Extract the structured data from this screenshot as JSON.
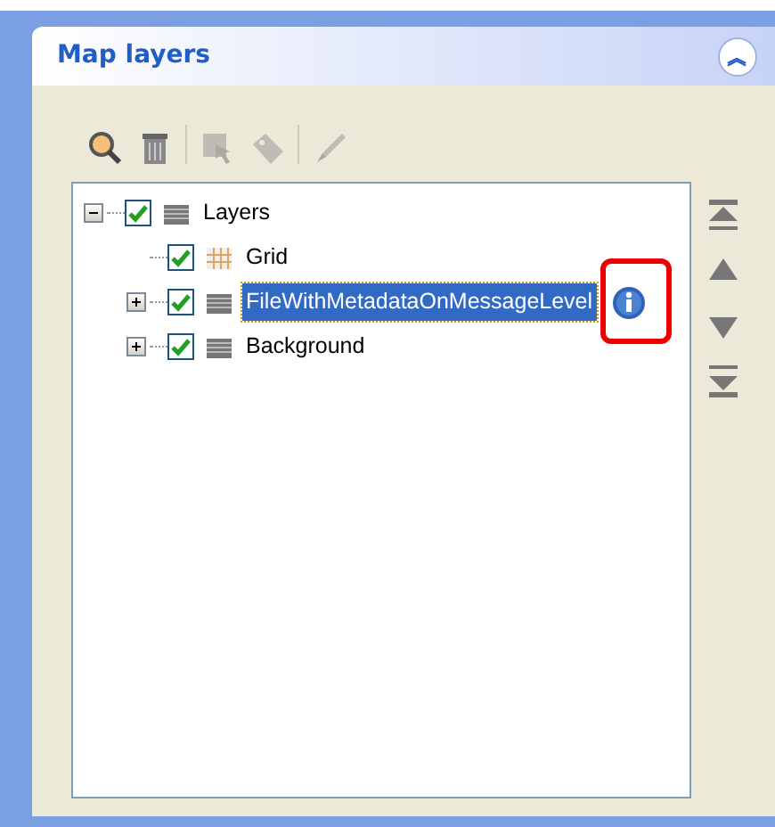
{
  "panel": {
    "title": "Map layers",
    "collapse_glyph": "︽",
    "expanded": true
  },
  "toolbar": [
    [
      {
        "kind": "zoom",
        "disabled": false
      },
      {
        "kind": "delete",
        "disabled": false
      }
    ],
    [
      {
        "kind": "select",
        "disabled": true
      },
      {
        "kind": "tag",
        "disabled": true
      }
    ],
    [
      {
        "kind": "brush",
        "disabled": true
      }
    ]
  ],
  "tree": [
    {
      "label": "Layers",
      "kind": "stack",
      "checked": true,
      "expanded": true,
      "selected": false,
      "children": [
        {
          "label": "Grid",
          "kind": "grid",
          "checked": true,
          "selected": false
        },
        {
          "label": "FileWithMetadataOnMessageLevel",
          "kind": "stack",
          "checked": true,
          "expanded": false,
          "selected": true,
          "info": true,
          "highlighted": true
        },
        {
          "label": "Background",
          "kind": "stack",
          "checked": true,
          "expanded": false,
          "selected": false
        }
      ]
    }
  ],
  "order_buttons": [
    {
      "kind": "top"
    },
    {
      "kind": "up"
    },
    {
      "kind": "down"
    },
    {
      "kind": "bottom"
    }
  ]
}
